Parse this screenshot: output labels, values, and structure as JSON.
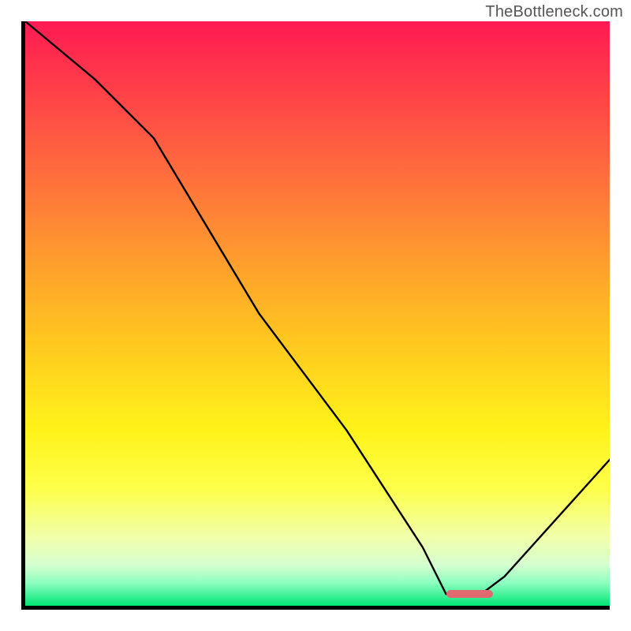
{
  "watermark": {
    "text": "TheBottleneck.com"
  },
  "colors": {
    "axis": "#000000",
    "curve": "#000000",
    "marker": "#e06a6f",
    "gradient_stops": [
      "#ff1a52",
      "#ff3a4a",
      "#ff6a3e",
      "#ff9a2e",
      "#ffc81f",
      "#fff31a",
      "#fdff4a",
      "#f2ffa8",
      "#d6ffd0",
      "#8fffc0",
      "#00e676"
    ]
  },
  "chart_data": {
    "type": "line",
    "title": "",
    "xlabel": "",
    "ylabel": "",
    "xlim": [
      0,
      100
    ],
    "ylim": [
      0,
      100
    ],
    "grid": false,
    "legend": false,
    "annotations": [
      {
        "kind": "watermark",
        "text": "TheBottleneck.com",
        "position": "top-right"
      }
    ],
    "series": [
      {
        "name": "bottleneck-curve",
        "x": [
          0,
          12,
          22,
          40,
          55,
          68,
          72,
          78,
          82,
          100
        ],
        "y": [
          100,
          90,
          80,
          50,
          30,
          10,
          2,
          2,
          5,
          25
        ]
      }
    ],
    "marker": {
      "name": "optimal-range",
      "x_start": 72,
      "x_end": 80,
      "y": 2
    }
  }
}
